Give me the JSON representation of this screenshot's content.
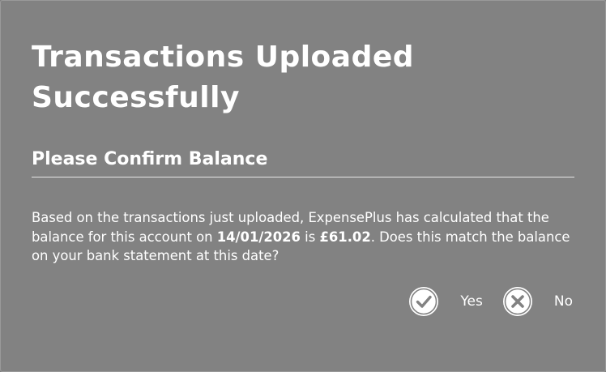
{
  "dialog": {
    "title": "Transactions Uploaded Successfully",
    "subtitle": "Please Confirm Balance",
    "message": {
      "part1": "Based on the transactions just uploaded, ExpensePlus has calculated that the balance for this account on ",
      "date": "14/01/2026",
      "part2": " is ",
      "amount": "£61.02",
      "part3": ". Does this match the balance on your bank statement at this date?"
    },
    "actions": {
      "yes_label": "Yes",
      "no_label": "No"
    }
  },
  "icons": {
    "yes": "check-circle-icon",
    "no": "x-circle-icon"
  },
  "colors": {
    "background": "#828282",
    "text": "#ffffff"
  }
}
